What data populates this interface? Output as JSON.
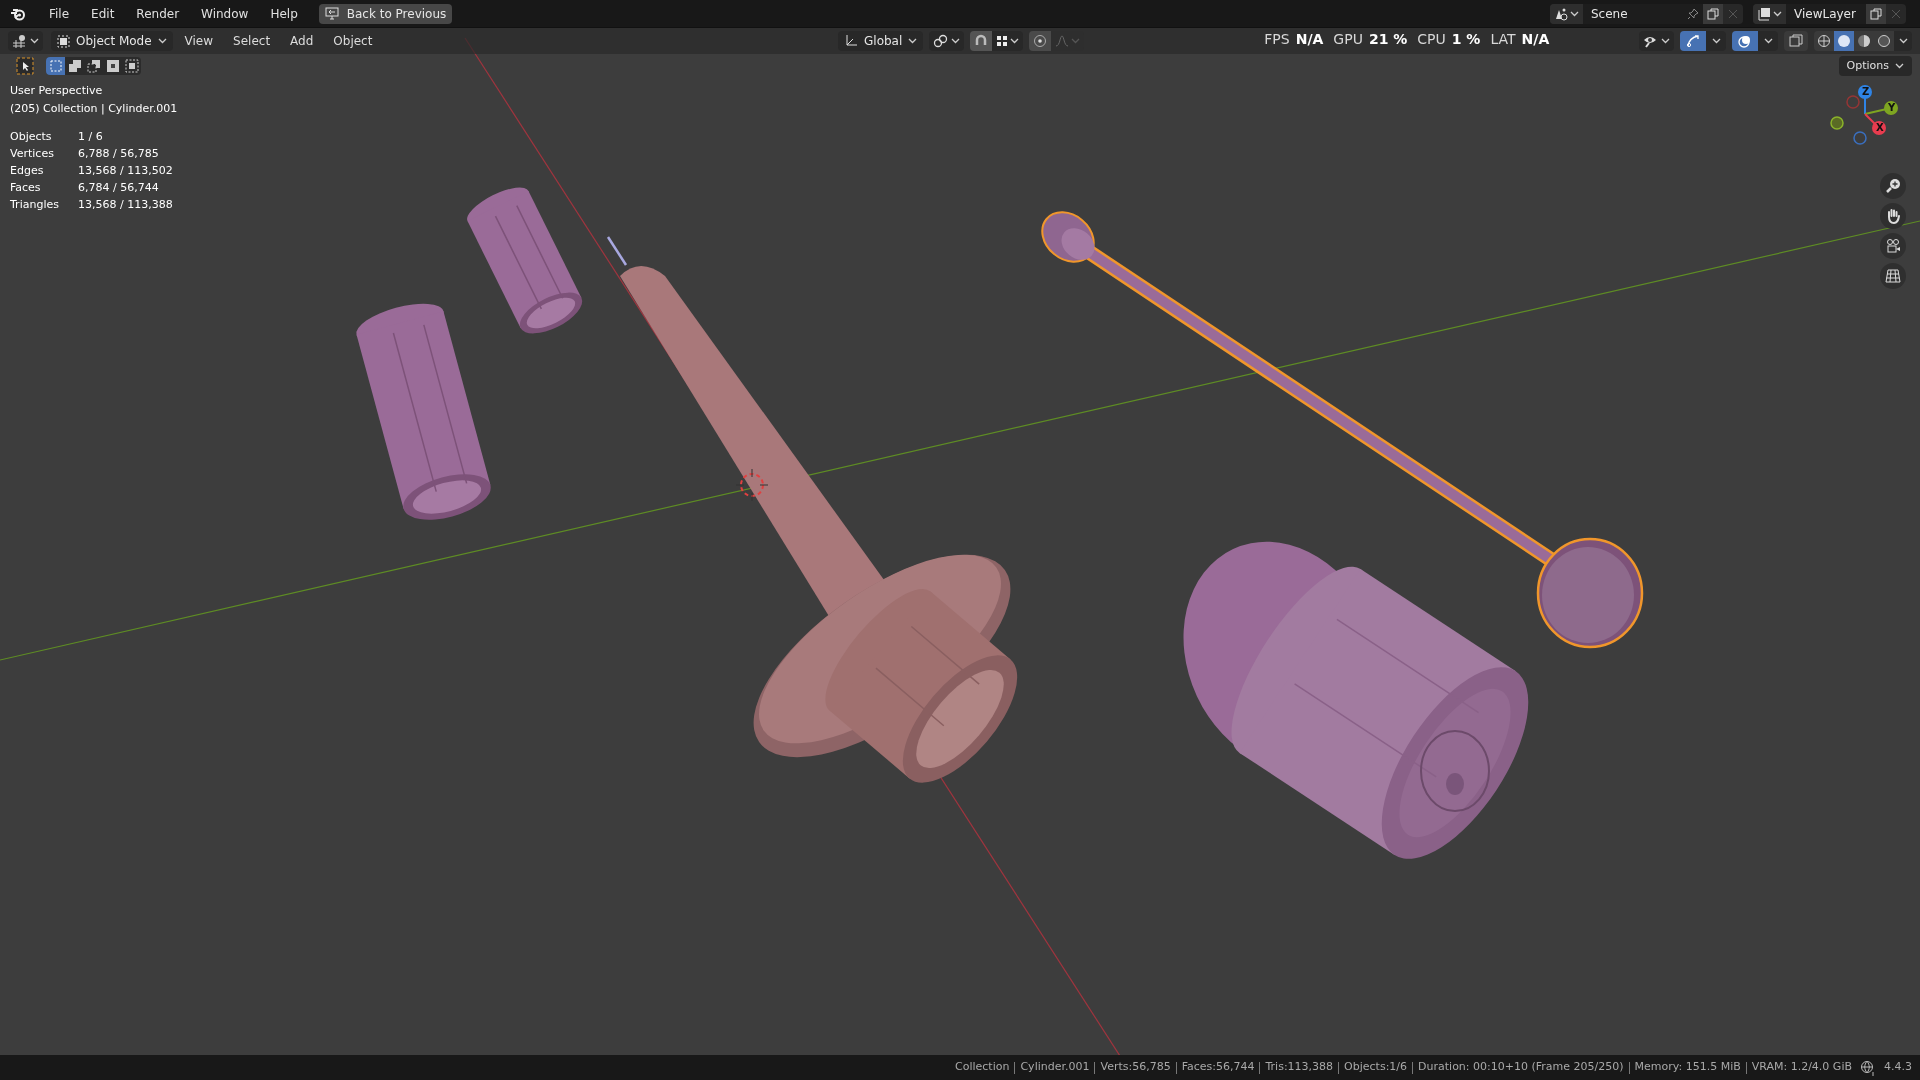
{
  "top_bar": {
    "menus": [
      "File",
      "Edit",
      "Render",
      "Window",
      "Help"
    ],
    "back_button": "Back to Previous",
    "scene": "Scene",
    "view_layer": "ViewLayer"
  },
  "viewport_header": {
    "mode": "Object Mode",
    "menus": [
      "View",
      "Select",
      "Add",
      "Object"
    ],
    "orientation": "Global",
    "readouts": [
      {
        "label": "FPS",
        "value": "N/A"
      },
      {
        "label": "GPU",
        "value": "21 %"
      },
      {
        "label": "CPU",
        "value": "1 %"
      },
      {
        "label": "LAT",
        "value": "N/A"
      }
    ],
    "gizmos_on": true,
    "overlays_on": true,
    "xray_on": false,
    "shading_modes": [
      {
        "kind": "wireframe",
        "selected": false
      },
      {
        "kind": "solid",
        "selected": true
      },
      {
        "kind": "material",
        "selected": false
      },
      {
        "kind": "rendered",
        "selected": false
      }
    ]
  },
  "tool_header": {
    "select_modes": [
      {
        "kind": "new",
        "selected": true
      },
      {
        "kind": "extend",
        "selected": false
      },
      {
        "kind": "subtract",
        "selected": false
      },
      {
        "kind": "difference",
        "selected": false
      },
      {
        "kind": "intersect",
        "selected": false
      }
    ],
    "options": "Options"
  },
  "overlay_text": {
    "view": "User Perspective",
    "context": "(205) Collection | Cylinder.001",
    "stats": [
      {
        "label": "Objects",
        "value": "1 / 6"
      },
      {
        "label": "Vertices",
        "value": "6,788 / 56,785"
      },
      {
        "label": "Edges",
        "value": "13,568 / 113,502"
      },
      {
        "label": "Faces",
        "value": "6,784 / 56,744"
      },
      {
        "label": "Triangles",
        "value": "13,568 / 113,388"
      }
    ]
  },
  "navigation_gizmo": {
    "axes": [
      "Z",
      "Y",
      "X"
    ]
  },
  "status_bar": {
    "segments": [
      "Collection",
      "Cylinder.001",
      "Verts:56,785",
      "Faces:56,744",
      "Tris:113,388",
      "Objects:1/6",
      "Duration: 00:10+10 (Frame 205/250)",
      "Memory: 151.5 MiB",
      "VRAM: 1.2/4.0 GiB"
    ],
    "version": "4.4.3"
  }
}
